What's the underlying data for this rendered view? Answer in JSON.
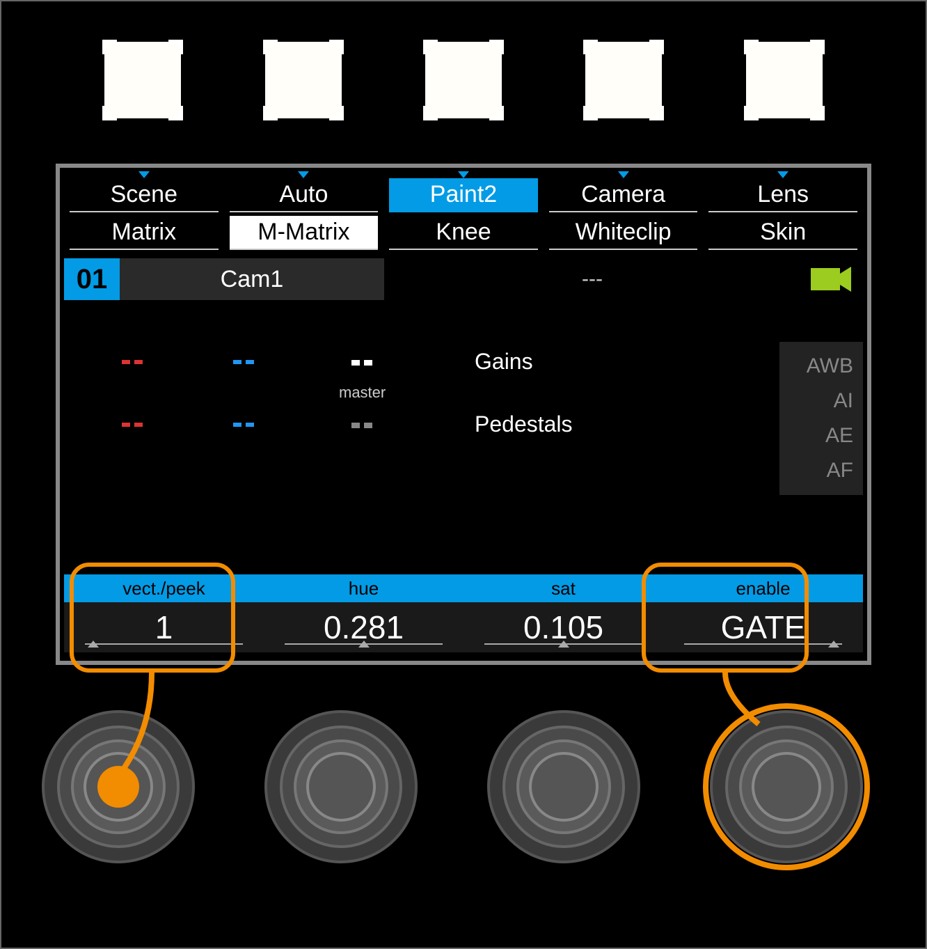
{
  "tabs_row1": [
    {
      "label": "Scene",
      "active": false
    },
    {
      "label": "Auto",
      "active": false
    },
    {
      "label": "Paint2",
      "active": true
    },
    {
      "label": "Camera",
      "active": false
    },
    {
      "label": "Lens",
      "active": false
    }
  ],
  "tabs_row2": [
    {
      "label": "Matrix",
      "active": false
    },
    {
      "label": "M-Matrix",
      "active": true
    },
    {
      "label": "Knee",
      "active": false
    },
    {
      "label": "Whiteclip",
      "active": false
    },
    {
      "label": "Skin",
      "active": false
    }
  ],
  "camera": {
    "number": "01",
    "name": "Cam1",
    "status": "---"
  },
  "mid_labels": {
    "master": "master",
    "gains": "Gains",
    "pedestals": "Pedestals"
  },
  "side_panel": [
    "AWB",
    "AI",
    "AE",
    "AF"
  ],
  "params": [
    {
      "label": "vect./peek",
      "value": "1"
    },
    {
      "label": "hue",
      "value": "0.281"
    },
    {
      "label": "sat",
      "value": "0.105"
    },
    {
      "label": "enable",
      "value": "GATE"
    }
  ]
}
